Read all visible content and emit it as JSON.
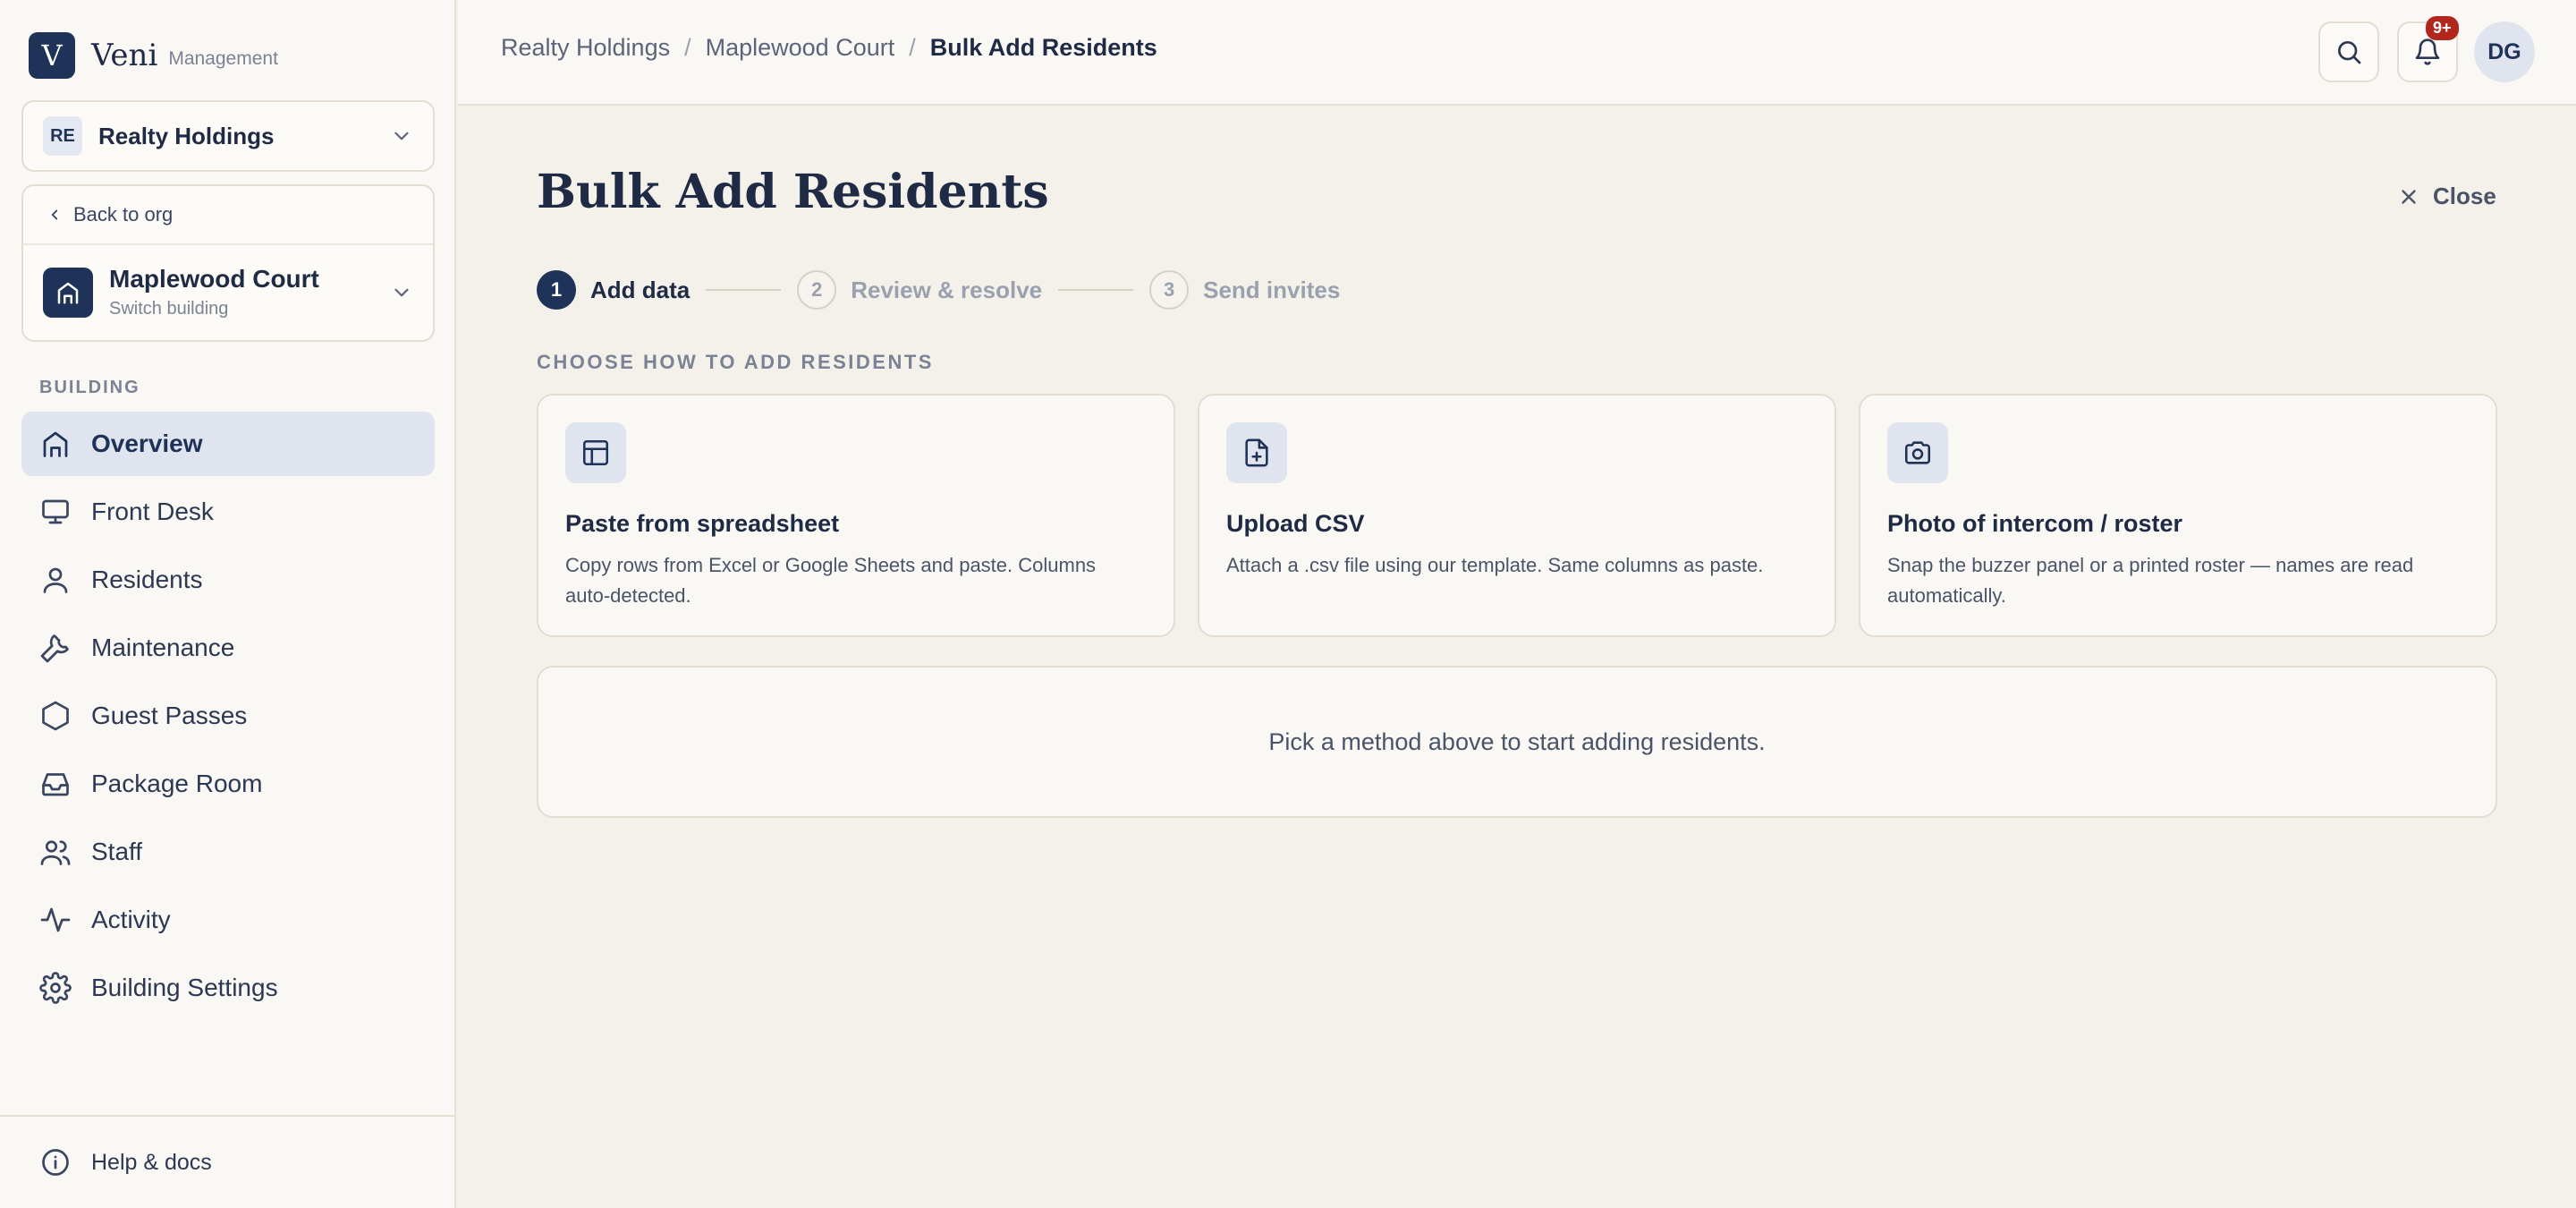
{
  "brand": {
    "logo_letter": "V",
    "name": "Veni",
    "subtitle": "Management"
  },
  "org": {
    "badge": "RE",
    "name": "Realty Holdings"
  },
  "building": {
    "back_label": "Back to org",
    "name": "Maplewood Court",
    "switch_label": "Switch building"
  },
  "sidebar": {
    "section_label": "BUILDING",
    "items": [
      {
        "label": "Overview",
        "icon": "home-icon",
        "active": true
      },
      {
        "label": "Front Desk",
        "icon": "monitor-icon"
      },
      {
        "label": "Residents",
        "icon": "user-icon"
      },
      {
        "label": "Maintenance",
        "icon": "wrench-icon"
      },
      {
        "label": "Guest Passes",
        "icon": "hexagon-icon"
      },
      {
        "label": "Package Room",
        "icon": "inbox-icon"
      },
      {
        "label": "Staff",
        "icon": "users-icon"
      },
      {
        "label": "Activity",
        "icon": "activity-icon"
      },
      {
        "label": "Building Settings",
        "icon": "gear-icon"
      }
    ],
    "help_label": "Help & docs"
  },
  "header": {
    "breadcrumb": [
      "Realty Holdings",
      "Maplewood Court",
      "Bulk Add Residents"
    ],
    "separator": "/",
    "notifications_badge": "9+",
    "avatar_initials": "DG"
  },
  "main": {
    "title": "Bulk Add Residents",
    "close_label": "Close",
    "steps": [
      {
        "num": "1",
        "label": "Add data",
        "state": "active"
      },
      {
        "num": "2",
        "label": "Review & resolve",
        "state": "todo"
      },
      {
        "num": "3",
        "label": "Send invites",
        "state": "todo"
      }
    ],
    "choose_label": "CHOOSE HOW TO ADD RESIDENTS",
    "methods": [
      {
        "title": "Paste from spreadsheet",
        "desc": "Copy rows from Excel or Google Sheets and paste. Columns auto‑detected.",
        "icon": "table-icon"
      },
      {
        "title": "Upload CSV",
        "desc": "Attach a .csv file using our template. Same columns as paste.",
        "icon": "file-plus-icon"
      },
      {
        "title": "Photo of intercom / roster",
        "desc": "Snap the buzzer panel or a printed roster — names are read automatically.",
        "icon": "camera-icon"
      }
    ],
    "empty_message": "Pick a method above to start adding residents."
  },
  "colors": {
    "accent": "#1f3257",
    "background": "#f4f1eb",
    "panel": "#faf8f4",
    "badge": "#b3261e"
  }
}
